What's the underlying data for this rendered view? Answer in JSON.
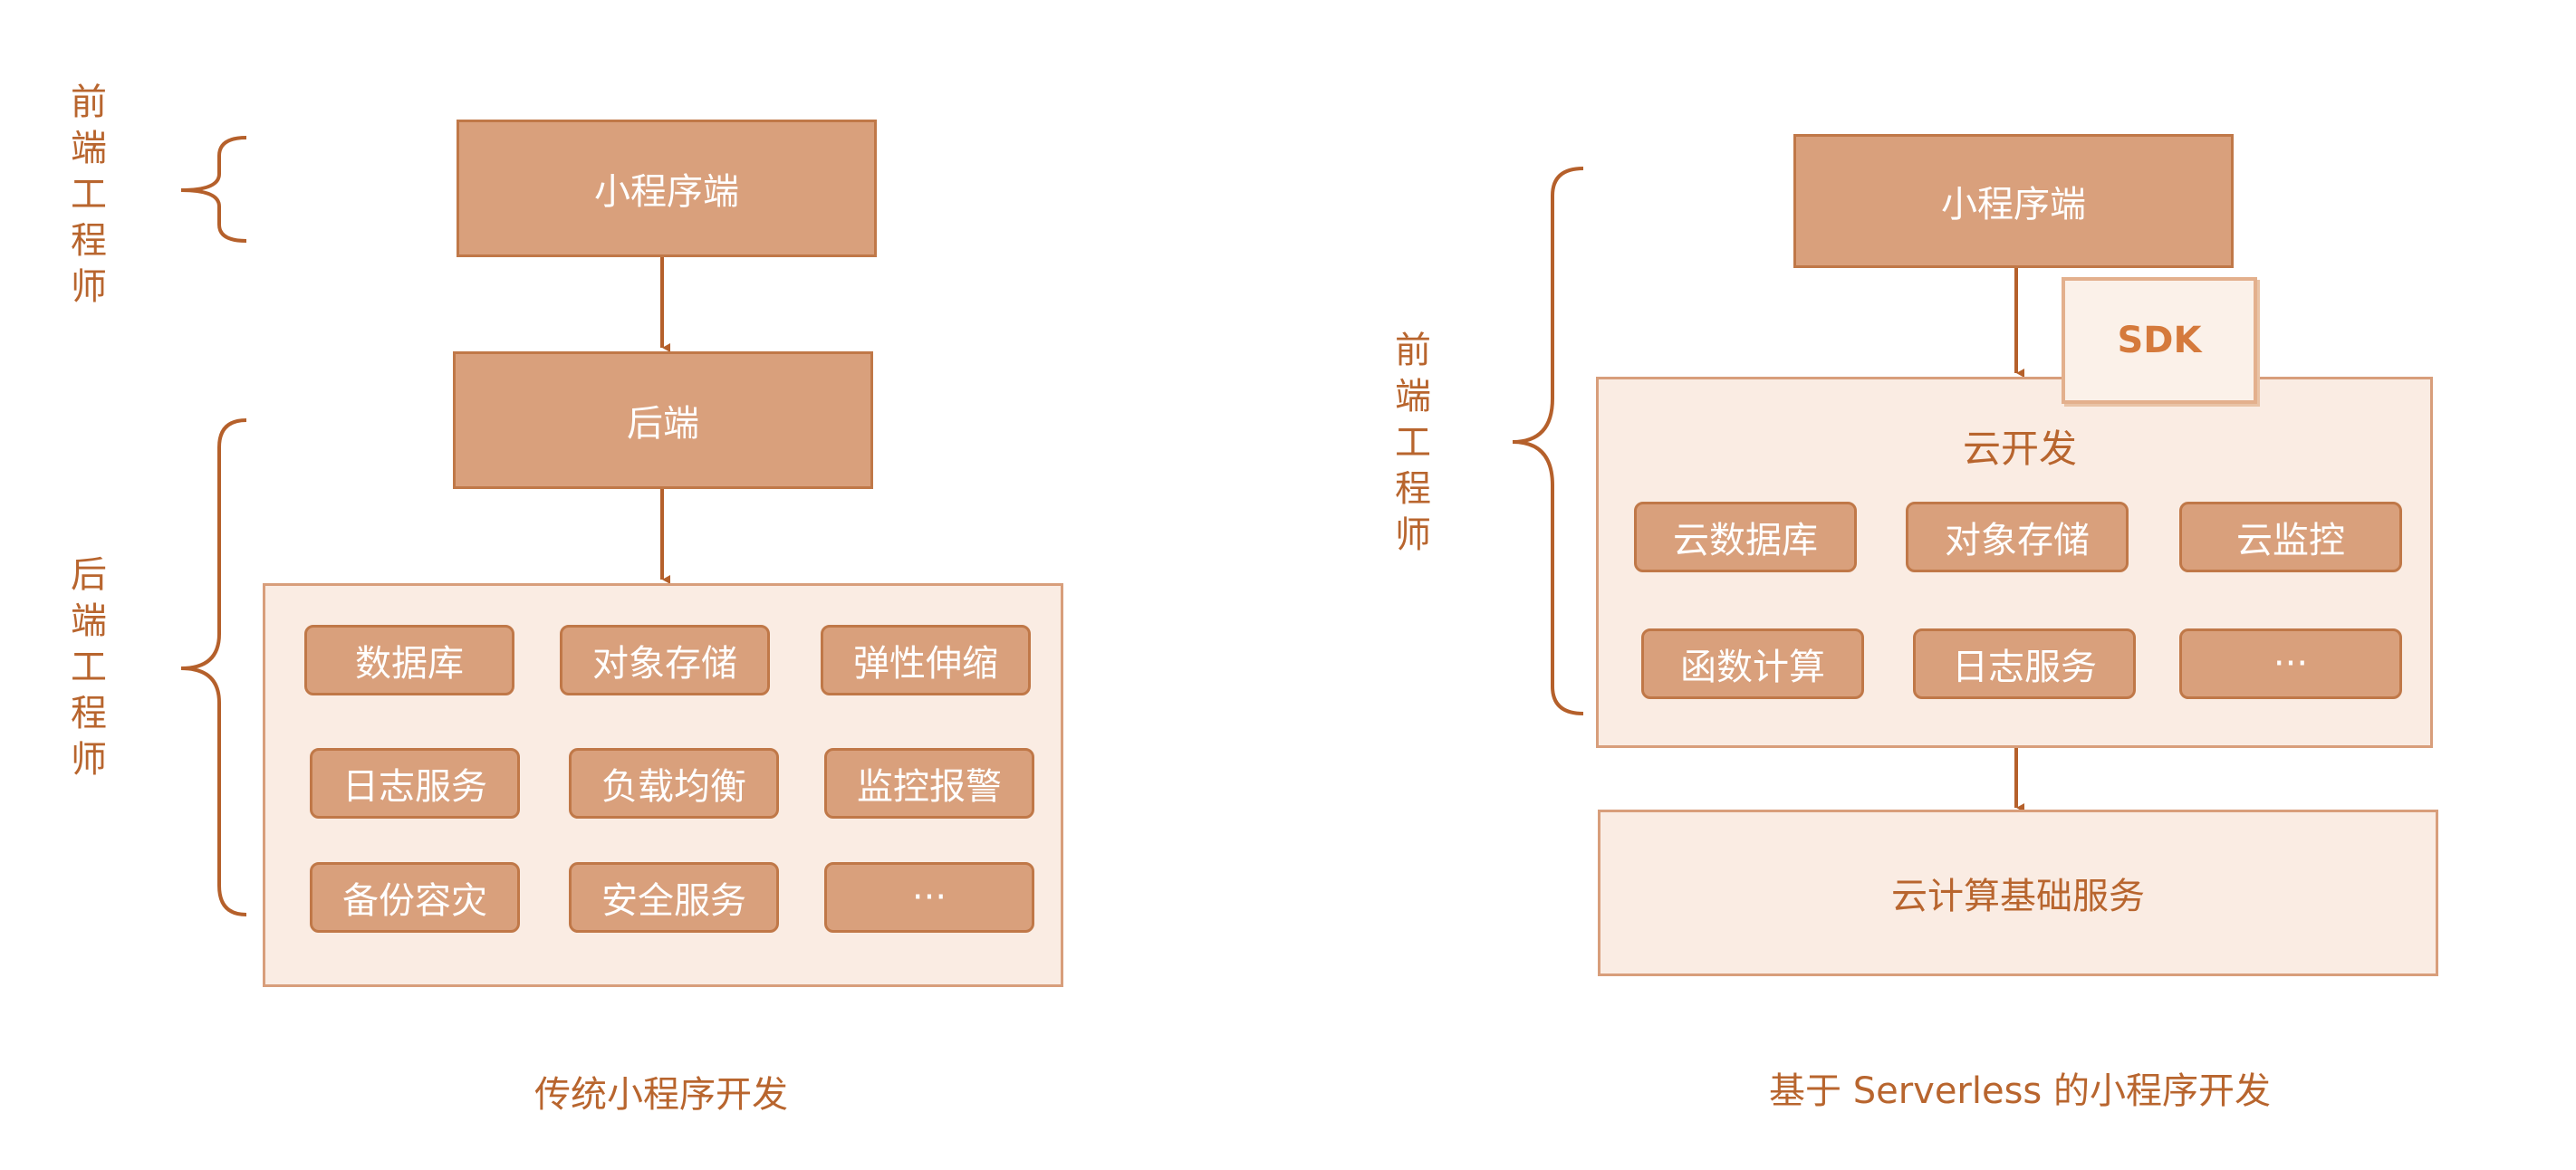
{
  "left": {
    "frontend_label": [
      "前",
      "端",
      "工",
      "程",
      "师"
    ],
    "backend_label": [
      "后",
      "端",
      "工",
      "程",
      "师"
    ],
    "miniprogram": "小程序端",
    "backend": "后端",
    "services": [
      "数据库",
      "对象存储",
      "弹性伸缩",
      "日志服务",
      "负载均衡",
      "监控报警",
      "备份容灾",
      "安全服务",
      "···"
    ],
    "caption": "传统小程序开发"
  },
  "right": {
    "frontend_label": [
      "前",
      "端",
      "工",
      "程",
      "师"
    ],
    "miniprogram": "小程序端",
    "sdk": "SDK",
    "cloud_dev_title": "云开发",
    "services": [
      "云数据库",
      "对象存储",
      "云监控",
      "函数计算",
      "日志服务",
      "···"
    ],
    "cloud_base": "云计算基础服务",
    "caption": "基于 Serverless 的小程序开发"
  },
  "colors": {
    "box_fill": "#d9a07c",
    "box_border": "#c07848",
    "panel_fill": "#faece3",
    "text_accent": "#b8652e",
    "arrow": "#b5602b"
  }
}
